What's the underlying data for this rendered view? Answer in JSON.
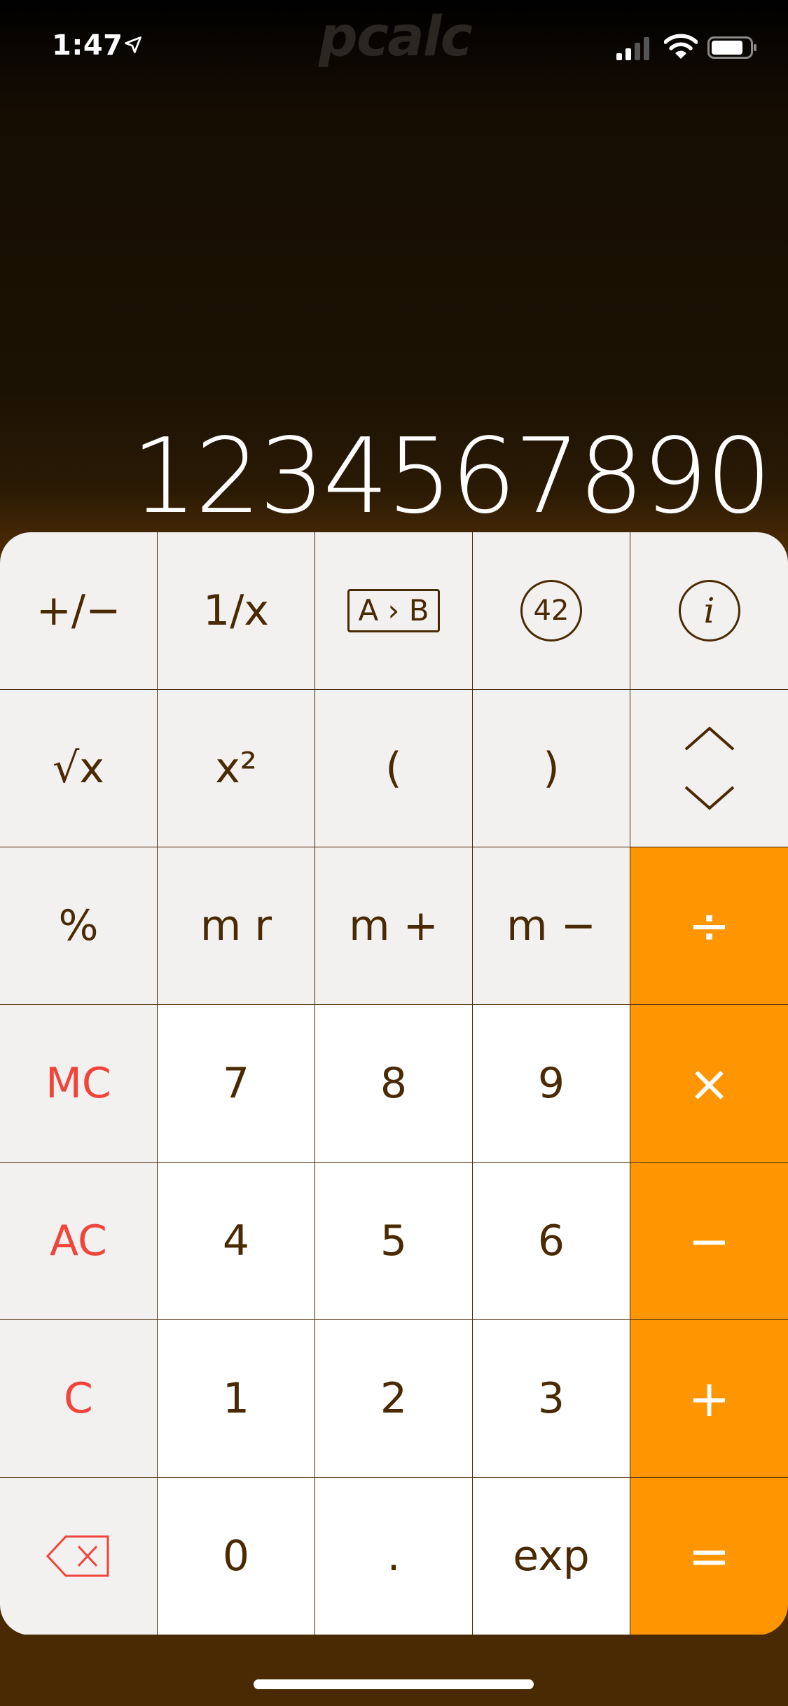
{
  "status_bar": {
    "time": "1:47",
    "location_icon": "location-arrow-icon",
    "signal_icon": "cellular-signal-icon",
    "wifi_icon": "wifi-icon",
    "battery_icon": "battery-icon"
  },
  "app": {
    "watermark": "pcalc"
  },
  "display": {
    "value": "1234567890"
  },
  "keys": {
    "row1": [
      "+/−",
      "1/x",
      "A › B",
      "42",
      "i"
    ],
    "row2": [
      "√x",
      "x²",
      "(",
      ")",
      "up-down-arrows"
    ],
    "row3": [
      "%",
      "m r",
      "m +",
      "m −",
      "÷"
    ],
    "row4": [
      "MC",
      "7",
      "8",
      "9",
      "×"
    ],
    "row5": [
      "AC",
      "4",
      "5",
      "6",
      "−"
    ],
    "row6": [
      "C",
      "1",
      "2",
      "3",
      "+"
    ],
    "row7": [
      "backspace",
      "0",
      ".",
      "exp",
      "="
    ]
  },
  "colors": {
    "accent_orange": "#ff9500",
    "key_text_brown": "#4a2a03",
    "clear_red": "#f0453a",
    "function_key_bg": "#f2f1f0",
    "number_key_bg": "#ffffff"
  }
}
